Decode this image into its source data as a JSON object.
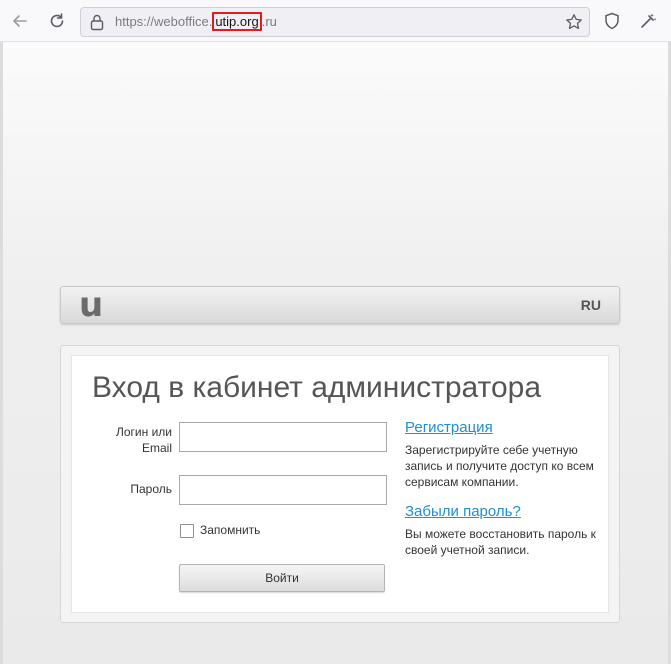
{
  "browser": {
    "url_prefix": "https://weboffice.",
    "url_host": "utip.org",
    "url_suffix": ".ru"
  },
  "header": {
    "logo": "u",
    "language": "RU"
  },
  "login": {
    "title": "Вход в кабинет администратора",
    "login_label": "Логин или Email",
    "password_label": "Пароль",
    "remember_label": "Запомнить",
    "submit_label": "Войти"
  },
  "register": {
    "link": "Регистрация",
    "description": "Зарегистрируйте себе учетную запись и получите доступ ко всем сервисам компании."
  },
  "forgot": {
    "link": "Забыли пароль?",
    "description": "Вы можете восстановить пароль к своей учетной записи."
  }
}
